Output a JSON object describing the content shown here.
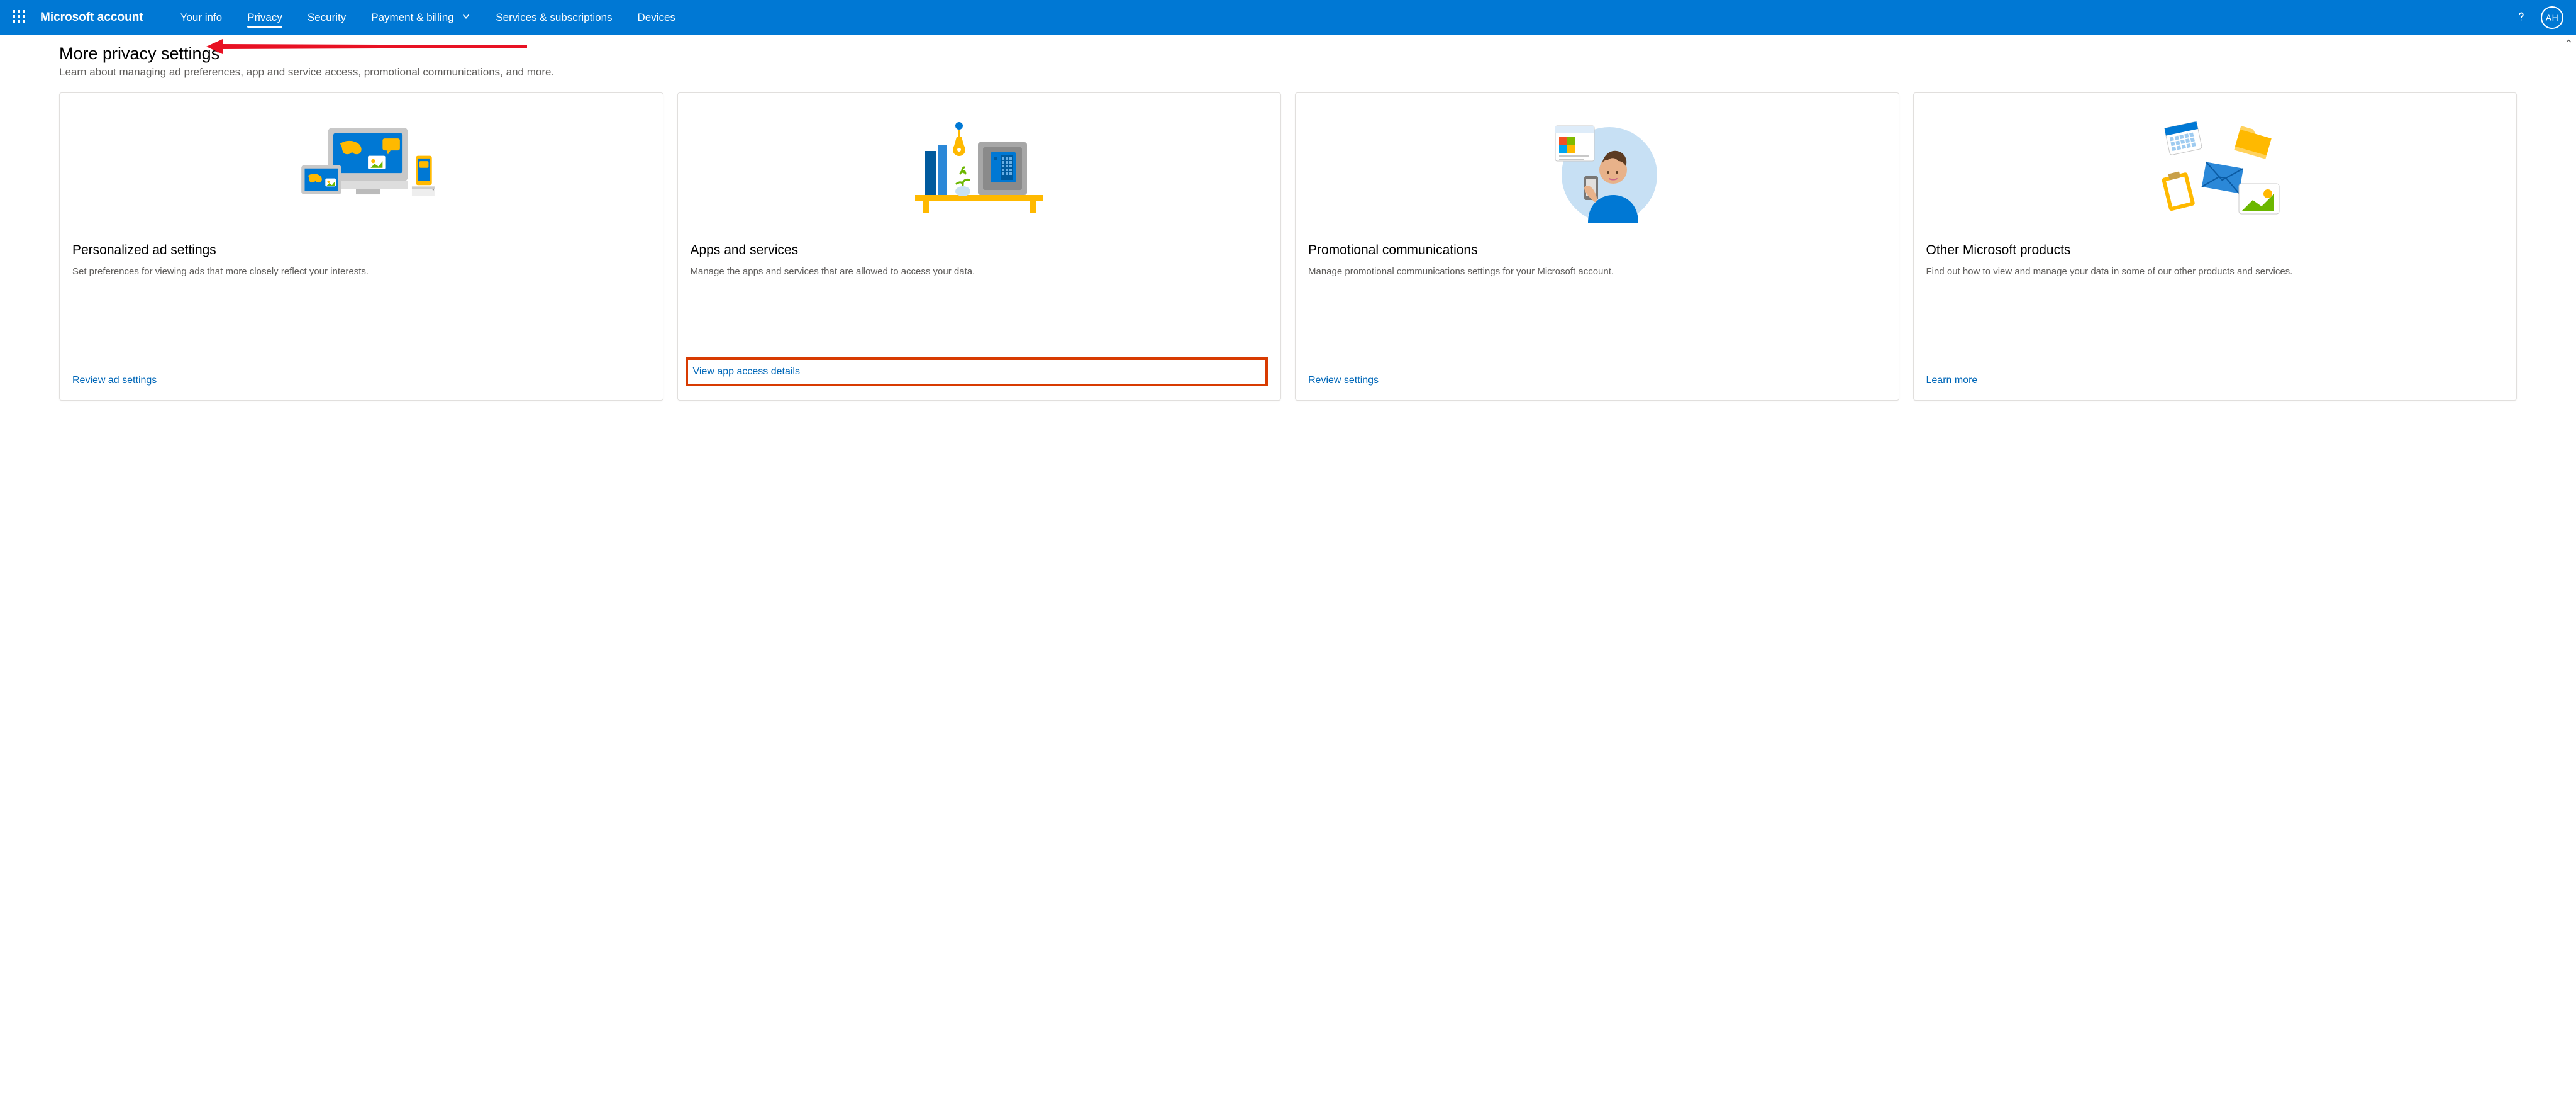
{
  "topbar": {
    "brand": "Microsoft account",
    "links": {
      "your_info": "Your info",
      "privacy": "Privacy",
      "security": "Security",
      "payment": "Payment & billing",
      "services": "Services & subscriptions",
      "devices": "Devices"
    },
    "avatar_initials": "AH"
  },
  "page": {
    "title": "More privacy settings",
    "subtitle": "Learn about managing ad preferences, app and service access, promotional communications, and more."
  },
  "cards": [
    {
      "title": "Personalized ad settings",
      "desc": "Set preferences for viewing ads that more closely reflect your interests.",
      "link": "Review ad settings"
    },
    {
      "title": "Apps and services",
      "desc": "Manage the apps and services that are allowed to access your data.",
      "link": "View app access details"
    },
    {
      "title": "Promotional communications",
      "desc": "Manage promotional communications settings for your Microsoft account.",
      "link": "Review settings"
    },
    {
      "title": "Other Microsoft products",
      "desc": "Find out how to view and manage your data in some of our other products and services.",
      "link": "Learn more"
    }
  ]
}
